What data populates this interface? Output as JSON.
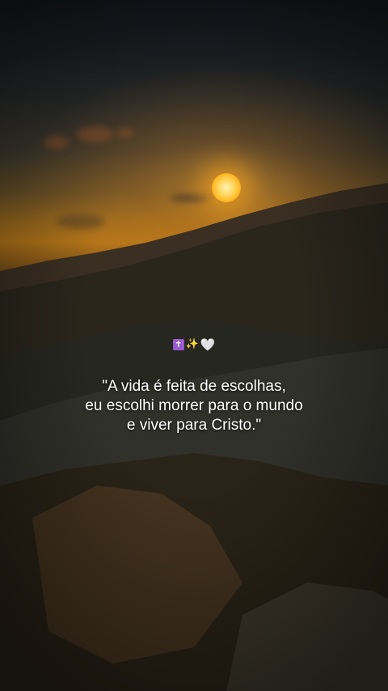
{
  "emojis": {
    "cross": "✝",
    "sparkles": "✨",
    "heart": "🤍"
  },
  "quote": {
    "line1": "\"A vida é feita de escolhas,",
    "line2": "eu escolhi morrer para o mundo",
    "line3": "e viver para Cristo.\""
  },
  "colors": {
    "sun": "#ffd45a",
    "sky_glow": "#b27519",
    "text": "#ffffff"
  }
}
